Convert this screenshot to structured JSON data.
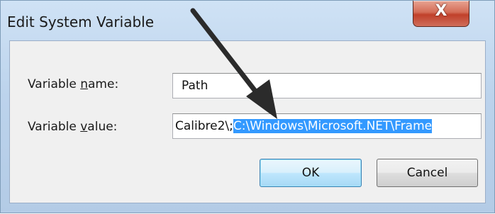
{
  "window": {
    "title": "Edit System Variable",
    "close_glyph": "X"
  },
  "form": {
    "name_label_prefix": "Variable ",
    "name_label_accel": "n",
    "name_label_suffix": "ame:",
    "name_value": "Path",
    "value_label_prefix": "Variable ",
    "value_label_accel": "v",
    "value_label_suffix": "alue:",
    "value_unselected": "Calibre2\\;",
    "value_selected": "C:\\Windows\\Microsoft.NET\\Frame"
  },
  "buttons": {
    "ok_label": "OK",
    "cancel_label": "Cancel"
  },
  "annotation": {
    "arrow_color": "#2b2b2b",
    "icon": "arrow-annotation-icon"
  }
}
